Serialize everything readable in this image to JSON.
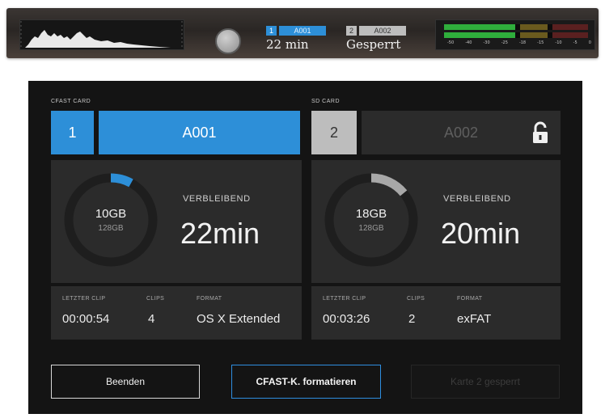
{
  "status_strip": {
    "slot1": {
      "index": "1",
      "name": "A001",
      "value": "22 min"
    },
    "slot2": {
      "index": "2",
      "name": "A002",
      "value": "Gesperrt"
    },
    "meter_scale": [
      "-50",
      "-40",
      "-30",
      "-25",
      "-18",
      "-15",
      "-10",
      "-5",
      "0"
    ]
  },
  "cards": [
    {
      "header": "CFAST CARD",
      "slot_number": "1",
      "name": "A001",
      "used": "10GB",
      "total": "128GB",
      "used_fraction": 0.08,
      "remaining_label": "VERBLEIBEND",
      "remaining_value": "22min",
      "last_clip_label": "LETZTER CLIP",
      "last_clip": "00:00:54",
      "clips_label": "CLIPS",
      "clips": "4",
      "format_label": "FORMAT",
      "format": "OS X Extended",
      "locked": false
    },
    {
      "header": "SD CARD",
      "slot_number": "2",
      "name": "A002",
      "used": "18GB",
      "total": "128GB",
      "used_fraction": 0.14,
      "remaining_label": "VERBLEIBEND",
      "remaining_value": "20min",
      "last_clip_label": "LETZTER CLIP",
      "last_clip": "00:03:26",
      "clips_label": "CLIPS",
      "clips": "2",
      "format_label": "FORMAT",
      "format": "exFAT",
      "locked": true
    }
  ],
  "buttons": {
    "quit": "Beenden",
    "format_cfast": "CFAST-K. formatieren",
    "card2_locked": "Karte 2 gesperrt"
  },
  "icons": {
    "record": "record-button-icon",
    "lock": "lock-icon"
  },
  "colors": {
    "accent_blue": "#2d8fd8",
    "ring_blue": "#2d8fd8",
    "ring_gray": "#a8a8a8",
    "panel_bg": "#141414",
    "card_bg": "#2b2b2b"
  }
}
